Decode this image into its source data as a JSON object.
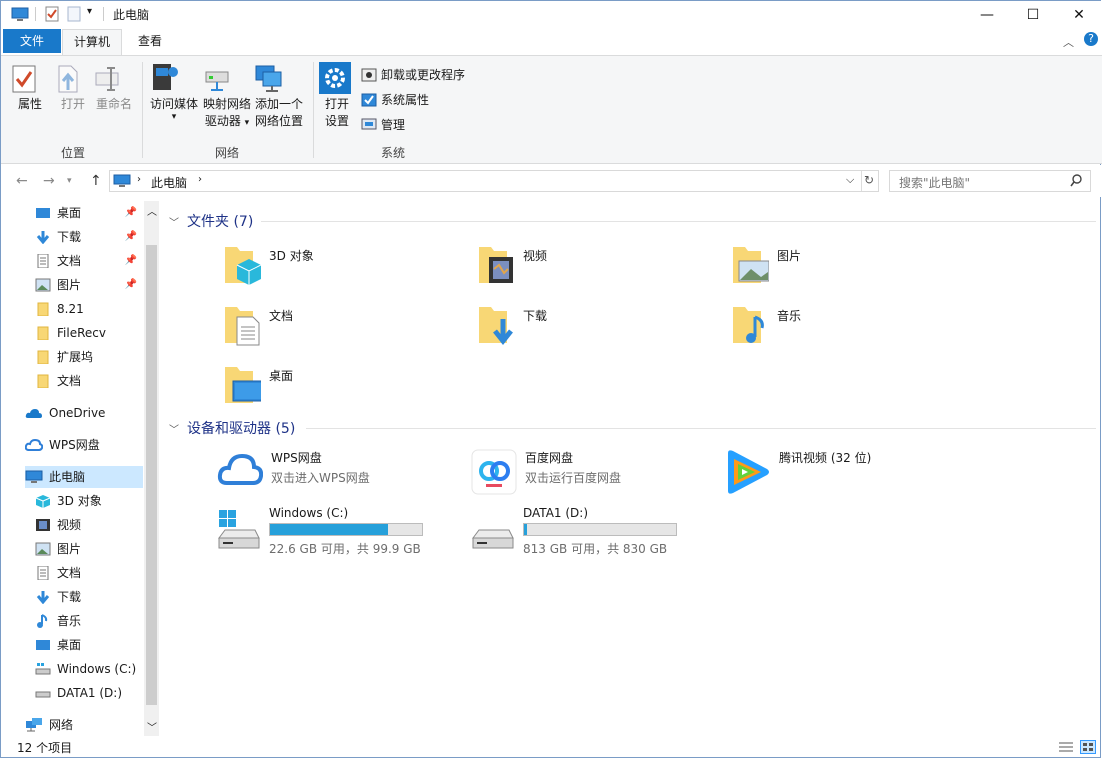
{
  "window": {
    "title": "此电脑",
    "minimize": "—",
    "maximize": "☐",
    "close": "✕"
  },
  "tabs": {
    "file": "文件",
    "computer": "计算机",
    "view": "查看"
  },
  "ribbon": {
    "location": {
      "group": "位置",
      "properties": "属性",
      "open": "打开",
      "rename": "重命名"
    },
    "network": {
      "group": "网络",
      "media_1": "访问媒体",
      "map_drive_1": "映射网络",
      "map_drive_2": "驱动器",
      "add_location_1": "添加一个",
      "add_location_2": "网络位置"
    },
    "system": {
      "group": "系统",
      "open_settings_1": "打开",
      "open_settings_2": "设置",
      "uninstall": "卸载或更改程序",
      "sys_props": "系统属性",
      "manage": "管理"
    }
  },
  "address": {
    "path": "此电脑",
    "search_placeholder": "搜索\"此电脑\""
  },
  "nav": {
    "quick": [
      {
        "label": "桌面",
        "pinned": true
      },
      {
        "label": "下载",
        "pinned": true
      },
      {
        "label": "文档",
        "pinned": true
      },
      {
        "label": "图片",
        "pinned": true
      },
      {
        "label": "8.21"
      },
      {
        "label": "FileRecv"
      },
      {
        "label": "扩展坞"
      },
      {
        "label": "文档"
      }
    ],
    "onedrive": "OneDrive",
    "wps": "WPS网盘",
    "thispc": "此电脑",
    "pc_children": [
      "3D 对象",
      "视频",
      "图片",
      "文档",
      "下载",
      "音乐",
      "桌面",
      "Windows (C:)",
      "DATA1 (D:)"
    ],
    "network": "网络"
  },
  "content": {
    "folders_header": "文件夹 (7)",
    "folders": [
      "3D 对象",
      "视频",
      "图片",
      "文档",
      "下载",
      "音乐",
      "桌面"
    ],
    "devices_header": "设备和驱动器 (5)",
    "wps": {
      "name": "WPS网盘",
      "desc": "双击进入WPS网盘"
    },
    "baidu": {
      "name": "百度网盘",
      "desc": "双击运行百度网盘"
    },
    "tencent": {
      "name": "腾讯视频 (32 位)"
    },
    "drive_c": {
      "name": "Windows (C:)",
      "free": "22.6 GB 可用，共 99.9 GB",
      "used_fraction": 0.774
    },
    "drive_d": {
      "name": "DATA1 (D:)",
      "free": "813 GB 可用，共 830 GB",
      "used_fraction": 0.02
    }
  },
  "status": {
    "count": "12 个项目"
  },
  "colors": {
    "accent": "#1979ca",
    "folder": "#f8d775",
    "drive_bar": "#26a0da"
  }
}
